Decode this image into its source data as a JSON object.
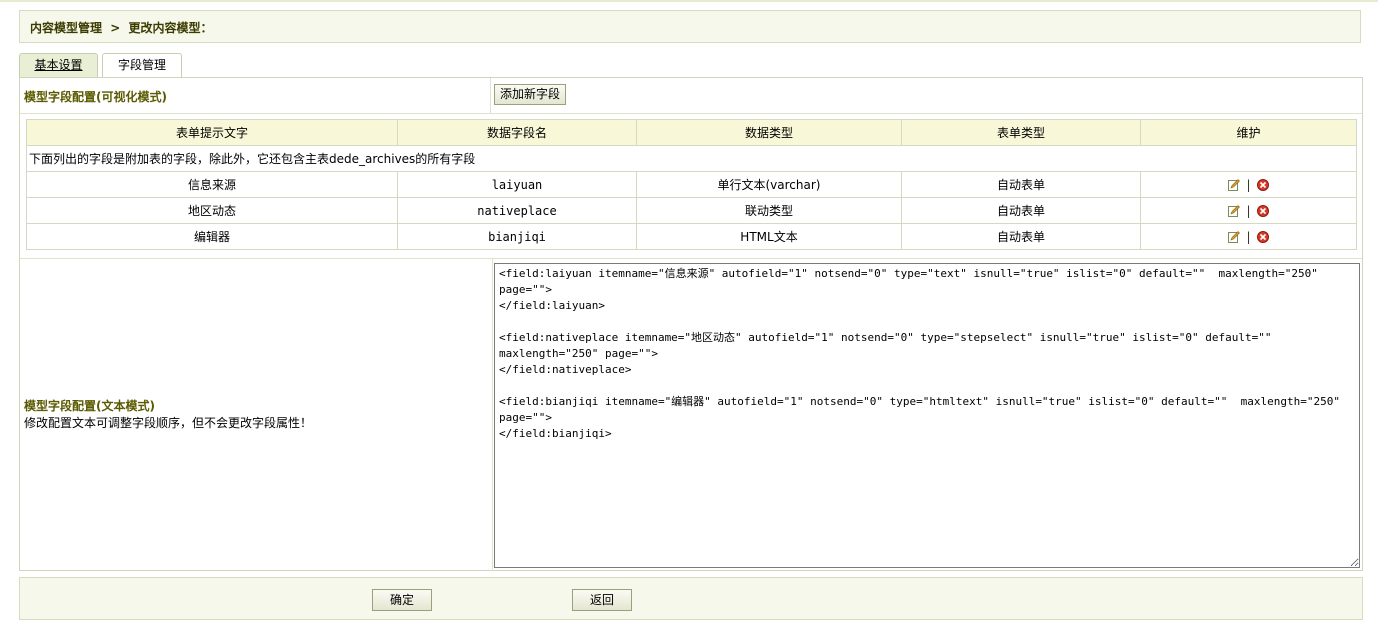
{
  "breadcrumb": {
    "parent": "内容模型管理",
    "separator": ">",
    "current": "更改内容模型："
  },
  "tabs": [
    {
      "label": "基本设置",
      "active": true
    },
    {
      "label": "字段管理",
      "active": false
    }
  ],
  "visual_section": {
    "title": "模型字段配置(可视化模式)",
    "add_button": "添加新字段"
  },
  "table": {
    "headers": [
      "表单提示文字",
      "数据字段名",
      "数据类型",
      "表单类型",
      "维护"
    ],
    "note": "下面列出的字段是附加表的字段，除此外，它还包含主表dede_archives的所有字段",
    "rows": [
      {
        "label": "信息来源",
        "field": "laiyuan",
        "datatype": "单行文本(varchar)",
        "formtype": "自动表单"
      },
      {
        "label": "地区动态",
        "field": "nativeplace",
        "datatype": "联动类型",
        "formtype": "自动表单"
      },
      {
        "label": "编辑器",
        "field": "bianjiqi",
        "datatype": "HTML文本",
        "formtype": "自动表单"
      }
    ],
    "action_separator": "|"
  },
  "text_section": {
    "title": "模型字段配置(文本模式)",
    "hint": "修改配置文本可调整字段顺序，但不会更改字段属性！",
    "config_text": "<field:laiyuan itemname=\"信息来源\" autofield=\"1\" notsend=\"0\" type=\"text\" isnull=\"true\" islist=\"0\" default=\"\"  maxlength=\"250\" page=\"\">\n</field:laiyuan>\n\n<field:nativeplace itemname=\"地区动态\" autofield=\"1\" notsend=\"0\" type=\"stepselect\" isnull=\"true\" islist=\"0\" default=\"\"  maxlength=\"250\" page=\"\">\n</field:nativeplace>\n\n<field:bianjiqi itemname=\"编辑器\" autofield=\"1\" notsend=\"0\" type=\"htmltext\" isnull=\"true\" islist=\"0\" default=\"\"  maxlength=\"250\" page=\"\">\n</field:bianjiqi>"
  },
  "footer": {
    "ok_button": "确定",
    "back_button": "返回"
  },
  "colors": {
    "accent_text": "#5a5a00",
    "header_bg": "#f8f7d8",
    "panel_bg": "#f7f8ec"
  },
  "icons": {
    "edit": "edit-icon",
    "delete": "delete-icon"
  }
}
